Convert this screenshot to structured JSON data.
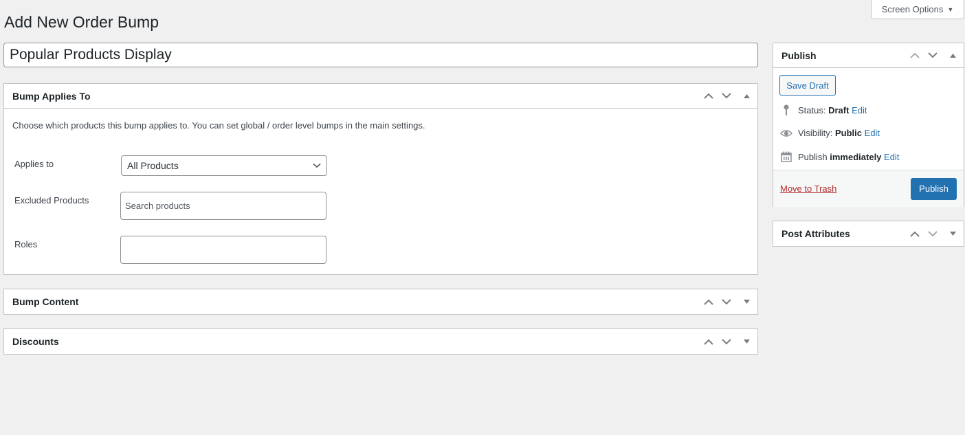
{
  "screen_options": {
    "label": "Screen Options"
  },
  "page": {
    "title": "Add New Order Bump"
  },
  "post_title": {
    "value": "Popular Products Display"
  },
  "main_boxes": {
    "bump_applies_to": {
      "title": "Bump Applies To",
      "description": "Choose which products this bump applies to. You can set global / order level bumps in the main settings.",
      "fields": {
        "applies_to": {
          "label": "Applies to",
          "value": "All Products"
        },
        "excluded_products": {
          "label": "Excluded Products",
          "placeholder": "Search products",
          "value": ""
        },
        "roles": {
          "label": "Roles",
          "value": ""
        }
      }
    },
    "bump_content": {
      "title": "Bump Content"
    },
    "discounts": {
      "title": "Discounts"
    }
  },
  "sidebar": {
    "publish": {
      "title": "Publish",
      "save_draft_label": "Save Draft",
      "status_label": "Status:",
      "status_value": "Draft",
      "visibility_label": "Visibility:",
      "visibility_value": "Public",
      "publish_label": "Publish",
      "publish_value": "immediately",
      "edit_label": "Edit",
      "trash_label": "Move to Trash",
      "publish_button_label": "Publish"
    },
    "post_attributes": {
      "title": "Post Attributes"
    }
  },
  "colors": {
    "accent": "#2271b1",
    "danger": "#b32d2e",
    "background": "#f0f0f1",
    "border": "#c3c4c7"
  }
}
